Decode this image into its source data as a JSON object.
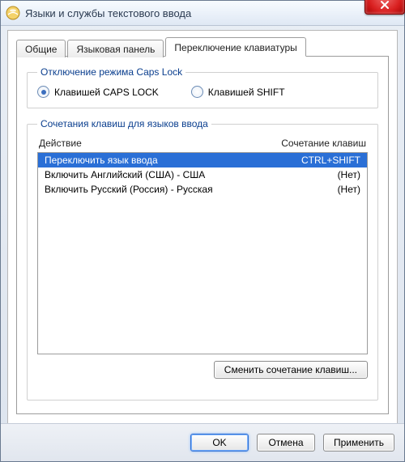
{
  "window": {
    "title": "Языки и службы текстового ввода"
  },
  "tabs": [
    {
      "label": "Общие"
    },
    {
      "label": "Языковая панель"
    },
    {
      "label": "Переключение клавиатуры"
    }
  ],
  "capslock_group": {
    "legend": "Отключение режима Caps Lock",
    "option_capslock": "Клавишей CAPS LOCK",
    "option_shift": "Клавишей SHIFT",
    "selected": "capslock"
  },
  "hotkeys_group": {
    "legend": "Сочетания клавиш для языков ввода",
    "col_action": "Действие",
    "col_shortcut": "Сочетание клавиш",
    "rows": [
      {
        "action": "Переключить язык ввода",
        "shortcut": "CTRL+SHIFT",
        "selected": true
      },
      {
        "action": "Включить Английский (США) - США",
        "shortcut": "(Нет)",
        "selected": false
      },
      {
        "action": "Включить Русский (Россия) - Русская",
        "shortcut": "(Нет)",
        "selected": false
      }
    ],
    "change_button": "Сменить сочетание клавиш..."
  },
  "footer": {
    "ok": "OK",
    "cancel": "Отмена",
    "apply": "Применить"
  }
}
